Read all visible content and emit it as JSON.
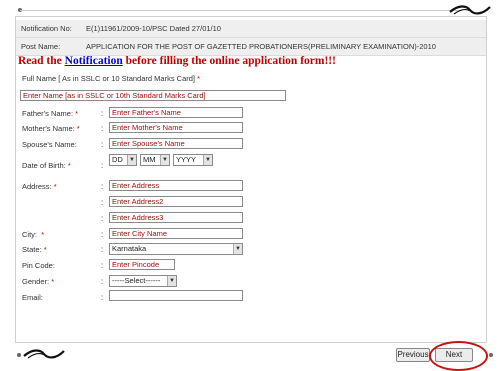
{
  "notification": {
    "no_label": "Notification No:",
    "no_value": "E(1)11961/2009-10/PSC Dated 27/01/10",
    "post_label": "Post Name:",
    "post_value": "APPLICATION FOR THE POST OF GAZETTED PROBATIONERS(PRELIMINARY EXAMINATION)-2010"
  },
  "warning": {
    "before": "Read the ",
    "link": "Notification",
    "after": " before filling the online application form!!!"
  },
  "form": {
    "full_name_label": "Full Name [ As in SSLC or 10 Standard Marks Card]",
    "full_name_value": "Enter Name [as in SSLC or 10th Standard Marks Card]",
    "father_label": "Father's Name:",
    "father_value": "Enter Father's Name",
    "mother_label": "Mother's Name:",
    "mother_value": "Enter Mother's Name",
    "spouse_label": "Spouse's Name:",
    "spouse_value": "Enter Spouse's Name",
    "dob_label": "Date of Birth:",
    "dob_day": "DD",
    "dob_month": "MM",
    "dob_year": "YYYY",
    "address_label": "Address:",
    "address1_value": "Enter Address",
    "address2_value": "Enter Address2",
    "address3_value": "Enter Address3",
    "city_label": "City:",
    "city_value": "Enter City Name",
    "state_label": "State:",
    "state_value": "Karnataka",
    "pin_label": "Pin Code:",
    "pin_value": "Enter Pincode",
    "gender_label": "Gender:",
    "gender_value": "-----Select------",
    "email_label": "Email:",
    "email_value": "",
    "required_mark": "*",
    "colon": ":"
  },
  "nav": {
    "previous_label": "Previous",
    "next_label": "Next"
  },
  "colors": {
    "accent_red": "#c00000",
    "link_blue": "#0000cc",
    "highlight_ring": "#cc1111"
  }
}
